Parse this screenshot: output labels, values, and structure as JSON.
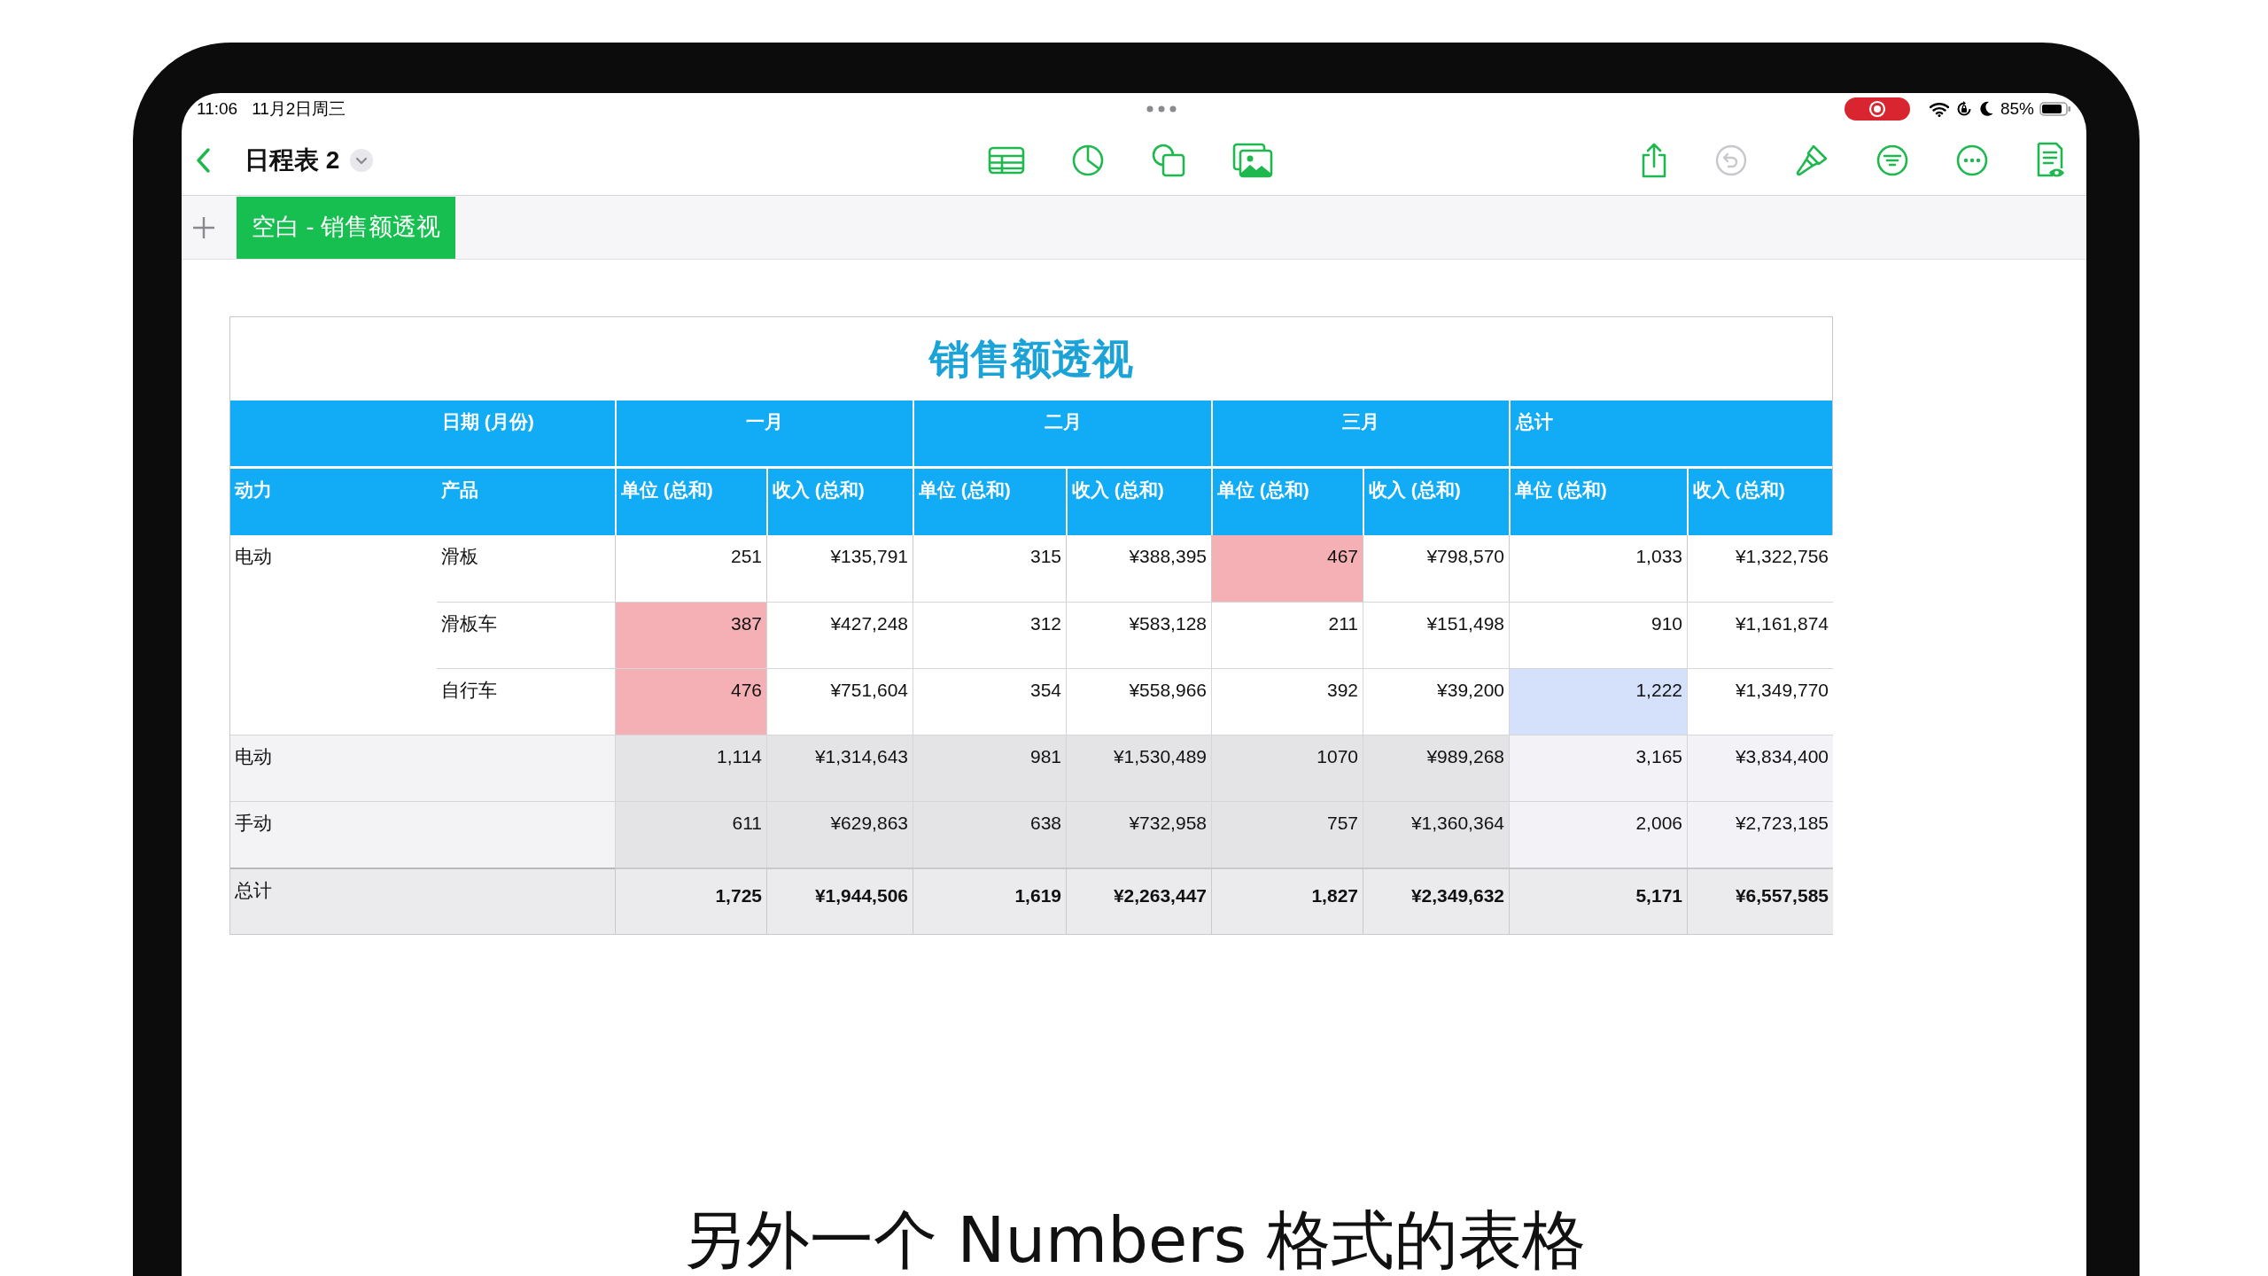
{
  "status_bar": {
    "time": "11:06",
    "date": "11月2日周三",
    "battery": "85%"
  },
  "toolbar": {
    "title": "日程表 2",
    "undo": {
      "disabled": true
    }
  },
  "sheet_tabs": [
    {
      "label": "空白 - 销售额透视",
      "selected": true
    }
  ],
  "table": {
    "title": "销售额透视",
    "header_row_1": [
      "日期 (月份)",
      "一月",
      "二月",
      "三月",
      "总计"
    ],
    "header_row_2": [
      "动力",
      "产品",
      "单位 (总和)",
      "收入 (总和)",
      "单位 (总和)",
      "收入 (总和)",
      "单位 (总和)",
      "收入 (总和)",
      "单位 (总和)",
      "收入 (总和)"
    ],
    "rows": [
      {
        "kind": "detail",
        "power": "电动",
        "product": "滑板",
        "cells": [
          {
            "text": "251"
          },
          {
            "text": "¥135,791"
          },
          {
            "text": "315"
          },
          {
            "text": "¥388,395"
          },
          {
            "text": "467",
            "color": "#f4b0b4"
          },
          {
            "text": "¥798,570"
          },
          {
            "text": "1,033"
          },
          {
            "text": "¥1,322,756"
          }
        ]
      },
      {
        "kind": "detail",
        "product": "滑板车",
        "cells": [
          {
            "text": "387",
            "color": "#f4b0b4"
          },
          {
            "text": "¥427,248"
          },
          {
            "text": "312"
          },
          {
            "text": "¥583,128"
          },
          {
            "text": "211"
          },
          {
            "text": "¥151,498"
          },
          {
            "text": "910"
          },
          {
            "text": "¥1,161,874"
          }
        ]
      },
      {
        "kind": "detail",
        "product": "自行车",
        "cells": [
          {
            "text": "476",
            "color": "#f4b0b4"
          },
          {
            "text": "¥751,604"
          },
          {
            "text": "354"
          },
          {
            "text": "¥558,966"
          },
          {
            "text": "392"
          },
          {
            "text": "¥39,200"
          },
          {
            "text": "1,222",
            "color": "#d5e1fb"
          },
          {
            "text": "¥1,349,770"
          }
        ]
      },
      {
        "kind": "subtotal",
        "power": "电动",
        "cells": [
          {
            "text": "1,114"
          },
          {
            "text": "¥1,314,643"
          },
          {
            "text": "981"
          },
          {
            "text": "¥1,530,489"
          },
          {
            "text": "1070"
          },
          {
            "text": "¥989,268"
          },
          {
            "text": "3,165"
          },
          {
            "text": "¥3,834,400"
          }
        ]
      },
      {
        "kind": "subtotal",
        "power": "手动",
        "cells": [
          {
            "text": "611"
          },
          {
            "text": "¥629,863"
          },
          {
            "text": "638"
          },
          {
            "text": "¥732,958"
          },
          {
            "text": "757"
          },
          {
            "text": "¥1,360,364"
          },
          {
            "text": "2,006"
          },
          {
            "text": "¥2,723,185"
          }
        ]
      },
      {
        "kind": "total",
        "power": "总计",
        "cells": [
          {
            "text": "1,725"
          },
          {
            "text": "¥1,944,506"
          },
          {
            "text": "1,619"
          },
          {
            "text": "¥2,263,447"
          },
          {
            "text": "1,827"
          },
          {
            "text": "¥2,349,632"
          },
          {
            "text": "5,171"
          },
          {
            "text": "¥6,557,585"
          }
        ]
      }
    ]
  },
  "caption": "另外一个 Numbers 格式的表格"
}
